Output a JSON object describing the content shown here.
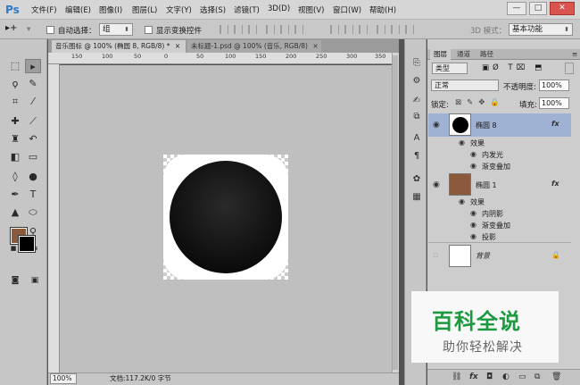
{
  "app": {
    "logo": "Ps"
  },
  "menu": [
    "文件(F)",
    "编辑(E)",
    "图像(I)",
    "图层(L)",
    "文字(Y)",
    "选择(S)",
    "滤镜(T)",
    "3D(D)",
    "视图(V)",
    "窗口(W)",
    "帮助(H)"
  ],
  "window_controls": {
    "minimize": "—",
    "maximize": "□",
    "close": "✕"
  },
  "options": {
    "auto_select_label": "自动选择：",
    "auto_select_value": "组",
    "show_transform_label": "显示变换控件",
    "mode_3d_label": "3D 模式：",
    "workspace": "基本功能"
  },
  "tabs": [
    {
      "label": "音乐图标 @ 100% (椭圆 8, RGB/8) *",
      "close": "×"
    },
    {
      "label": "未标题-1.psd @ 100% (音乐, RGB/8)",
      "close": "×"
    }
  ],
  "ruler_labels": [
    "150",
    "100",
    "50",
    "0",
    "50",
    "100",
    "150",
    "200",
    "250",
    "300",
    "350"
  ],
  "status": {
    "zoom": "100%",
    "doc_info": "文档:117.2K/0 字节"
  },
  "colors": {
    "foreground": "#8b5a3c",
    "background": "#000000",
    "accent_selected": "#9fb2d3"
  },
  "panel": {
    "tabs": [
      "图层",
      "通道",
      "路径"
    ],
    "filter_kind": "类型",
    "blend_mode": "正常",
    "opacity_label": "不透明度:",
    "opacity_value": "100%",
    "lock_label": "锁定:",
    "fill_label": "填充:",
    "fill_value": "100%"
  },
  "layers": [
    {
      "name": "椭圆 8",
      "effects_label": "效果",
      "effects": [
        "内发光",
        "渐变叠加"
      ],
      "fx": "fx",
      "selected": true
    },
    {
      "name": "椭圆 1",
      "effects_label": "效果",
      "effects": [
        "内阴影",
        "渐变叠加",
        "投影"
      ],
      "fx": "fx",
      "selected": false
    },
    {
      "name": "背景",
      "locked": true
    }
  ],
  "watermark": {
    "title": "百科全说",
    "subtitle": "助你轻松解决"
  }
}
